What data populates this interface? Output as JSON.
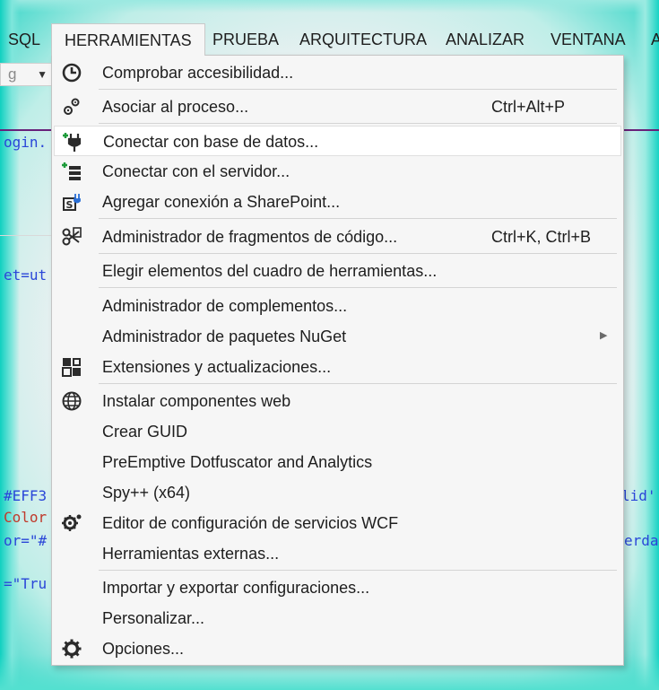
{
  "menubar": {
    "items": [
      "SQL",
      "HERRAMIENTAS",
      "PRUEBA",
      "ARQUITECTURA",
      "ANALIZAR",
      "VENTANA",
      "A"
    ]
  },
  "editor": {
    "combo_text": "g",
    "code_fragments": [
      {
        "text": "ogin.",
        "color": "#2a46d8"
      },
      {
        "text": "et=ut",
        "color": "#2a46d8"
      },
      {
        "text": "#EFF3",
        "color": "#2a46d8"
      },
      {
        "text": "Color",
        "color": "#c0392b"
      },
      {
        "text": "or=\"#",
        "color": "#2a46d8"
      },
      {
        "text": "=\"Tru",
        "color": "#2a46d8"
      },
      {
        "text": "lid'",
        "color": "#2a46d8"
      },
      {
        "text": "erda",
        "color": "#2a46d8"
      }
    ]
  },
  "menu": {
    "items": [
      {
        "label": "Comprobar accesibilidad...",
        "shortcut": "",
        "icon": "accessibility-check-icon"
      },
      {
        "label": "Asociar al proceso...",
        "shortcut": "Ctrl+Alt+P",
        "icon": "attach-process-icon"
      },
      {
        "label": "Conectar con base de datos...",
        "shortcut": "",
        "icon": "connect-database-icon"
      },
      {
        "label": "Conectar con el servidor...",
        "shortcut": "",
        "icon": "connect-server-icon"
      },
      {
        "label": "Agregar conexión a SharePoint...",
        "shortcut": "",
        "icon": "sharepoint-icon"
      },
      {
        "label": "Administrador de fragmentos de código...",
        "shortcut": "Ctrl+K, Ctrl+B",
        "icon": "code-snippets-icon"
      },
      {
        "label": "Elegir elementos del cuadro de herramientas...",
        "shortcut": "",
        "icon": ""
      },
      {
        "label": "Administrador de complementos...",
        "shortcut": "",
        "icon": ""
      },
      {
        "label": "Administrador de paquetes NuGet",
        "shortcut": "",
        "icon": ""
      },
      {
        "label": "Extensiones y actualizaciones...",
        "shortcut": "",
        "icon": "extensions-icon"
      },
      {
        "label": "Instalar componentes web",
        "shortcut": "",
        "icon": "web-components-icon"
      },
      {
        "label": "Crear GUID",
        "shortcut": "",
        "icon": ""
      },
      {
        "label": "PreEmptive Dotfuscator and Analytics",
        "shortcut": "",
        "icon": ""
      },
      {
        "label": "Spy++ (x64)",
        "shortcut": "",
        "icon": ""
      },
      {
        "label": "Editor de configuración de servicios WCF",
        "shortcut": "",
        "icon": "wcf-config-icon"
      },
      {
        "label": "Herramientas externas...",
        "shortcut": "",
        "icon": ""
      },
      {
        "label": "Importar y exportar configuraciones...",
        "shortcut": "",
        "icon": ""
      },
      {
        "label": "Personalizar...",
        "shortcut": "",
        "icon": ""
      },
      {
        "label": "Opciones...",
        "shortcut": "",
        "icon": "gear-icon"
      }
    ]
  },
  "colors": {
    "accent": "#68217a",
    "menu_bg": "#f6f6f6",
    "highlight": "#ffffff",
    "icon": "#2b2b2b",
    "icon_green": "#1c9b3a",
    "icon_blue": "#2a6fd6"
  }
}
